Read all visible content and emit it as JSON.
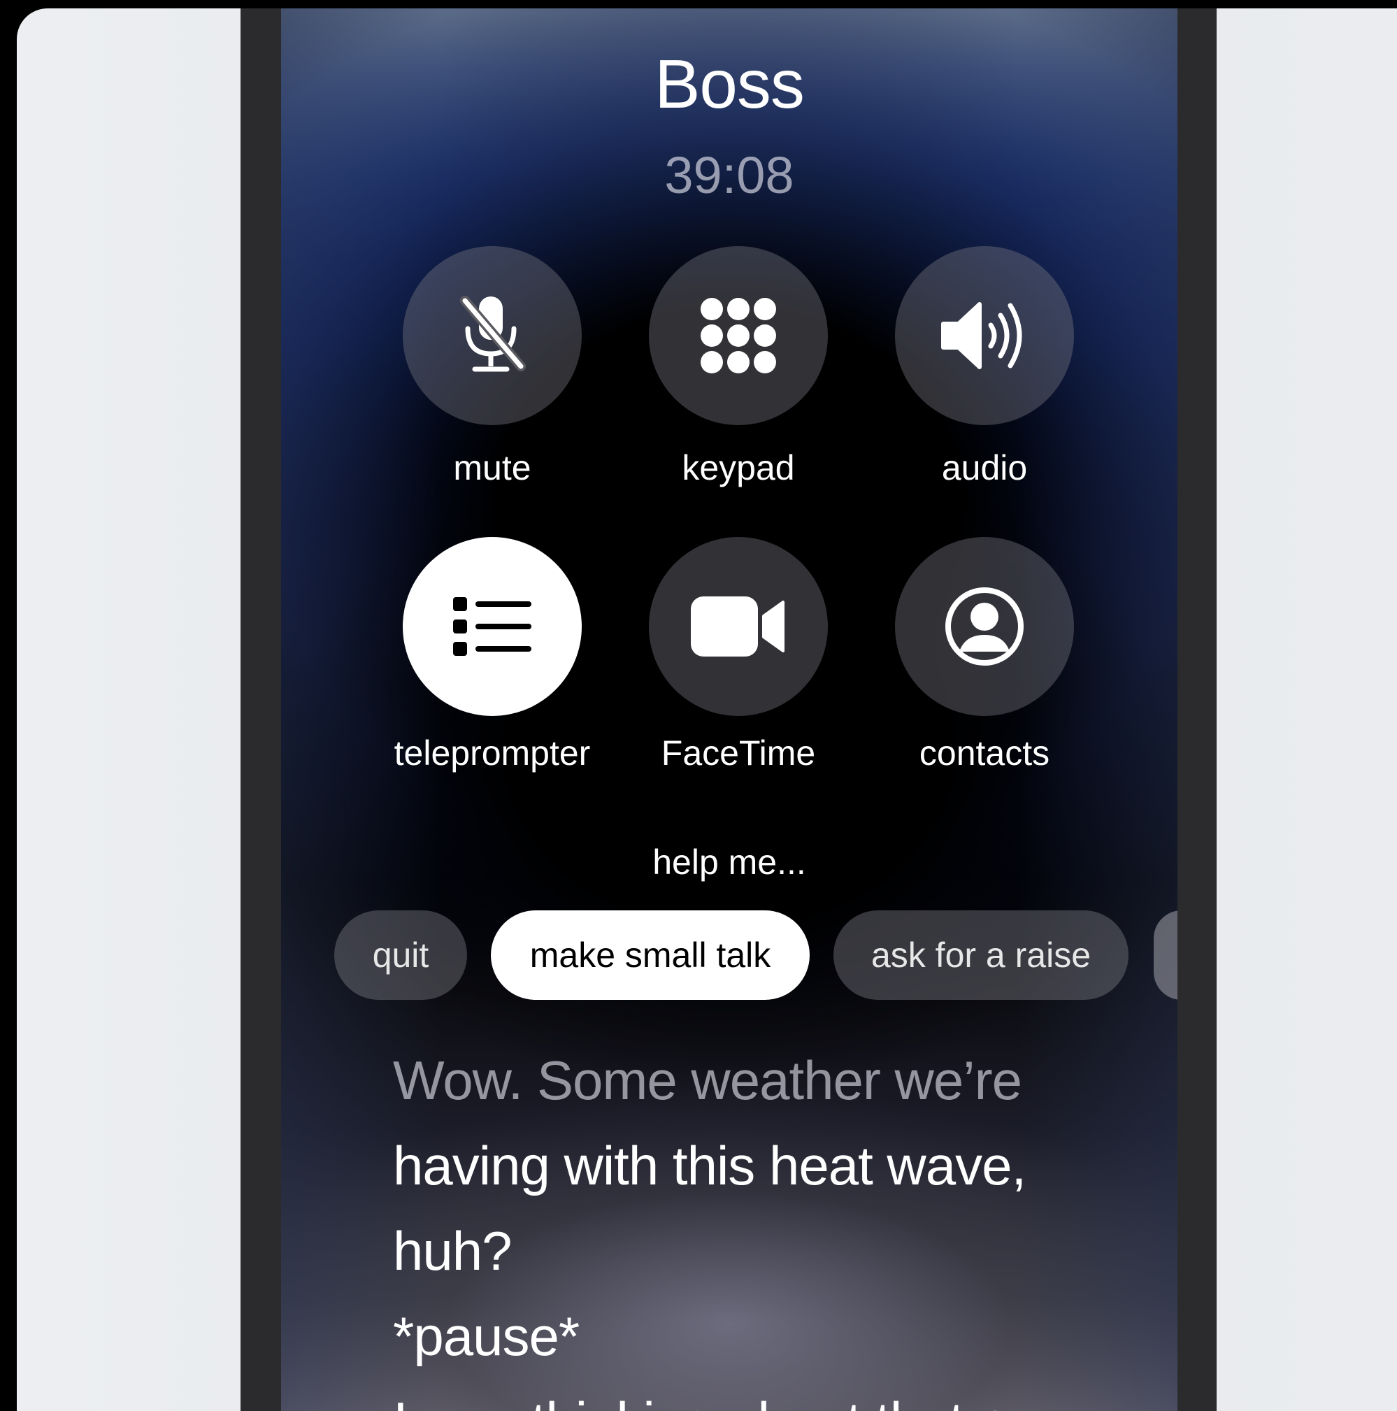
{
  "call": {
    "caller_name": "Boss",
    "duration": "39:08"
  },
  "controls": [
    {
      "label": "mute",
      "icon": "mic-slash-icon",
      "active": false
    },
    {
      "label": "keypad",
      "icon": "keypad-icon",
      "active": false
    },
    {
      "label": "audio",
      "icon": "speaker-icon",
      "active": false
    },
    {
      "label": "teleprompter",
      "icon": "list-icon",
      "active": true
    },
    {
      "label": "FaceTime",
      "icon": "video-camera-icon",
      "active": false
    },
    {
      "label": "contacts",
      "icon": "person-circle-icon",
      "active": false
    }
  ],
  "help": {
    "title": "help me...",
    "chips": [
      {
        "label": "quit",
        "selected": false
      },
      {
        "label": "make small talk",
        "selected": true
      },
      {
        "label": "ask for a raise",
        "selected": false
      }
    ]
  },
  "teleprompter": {
    "lines": [
      "Wow. Some weather we’re",
      "having with this heat wave,",
      "huh?",
      "*pause*",
      "I was thinking about that p"
    ]
  },
  "colors": {
    "active_button": "#ffffff",
    "button_fill": "#5a5a60",
    "accent_blue": "#133182"
  }
}
